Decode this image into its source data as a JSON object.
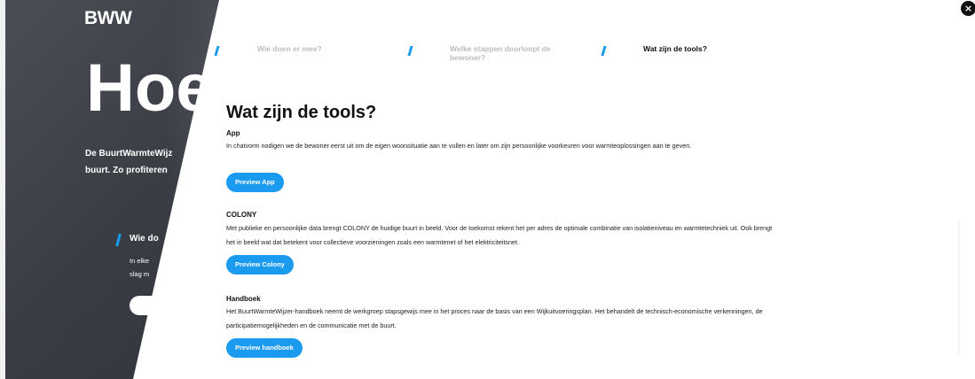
{
  "background": {
    "logo": "BWW",
    "hero_heading": "Hoe",
    "intro_line1": "De BuurtWarmteWijz",
    "intro_line2": "buurt. Zo profiteren",
    "sub_heading": "Wie do",
    "sub_text_line1": "In elke",
    "sub_text_line2": "slag m"
  },
  "close_icon": "×",
  "steps": [
    {
      "label": "Wie doen er mee?",
      "state": "inactive"
    },
    {
      "label": "Welke stappen doorloopt de bewoner?",
      "state": "inactive"
    },
    {
      "label": "Wat zijn de tools?",
      "state": "active"
    }
  ],
  "main": {
    "title": "Wat zijn de tools?",
    "sections": [
      {
        "heading": "App",
        "text": "In chatvorm nodigen we de bewoner eerst uit om de eigen woonsituatie aan te vullen en later om zijn persoonlijke voorkeuren voor warmteoplossingen aan te geven.",
        "button": "Preview App"
      },
      {
        "heading": "COLONY",
        "text": "Met publieke en persoonlijke data brengt COLONY de huidige buurt in beeld. Voor de toekomst rekent het per adres de optimale combinatie van isolatieniveau en warmtetechniek uit. Ook brengt het in beeld wat dat betekent voor collectieve voorzieningen zoals een warmtenet of het elektriciteitsnet.",
        "button": "Preview Colony"
      },
      {
        "heading": "Handboek",
        "text": "Het BuurtWarmteWijzer-handboek neemt de werkgroep stapsgewijs mee in het proces naar de basis van een Wijkuitvoeringsplan. Het behandelt de technisch-economische verkenningen, de participatiemogelijkheden en de communicatie met de buurt.",
        "button": "Preview handboek"
      }
    ]
  },
  "colors": {
    "accent": "#1a9bf0",
    "background_dark": "#3a3d44",
    "text": "#111111",
    "muted": "#bdbdbd"
  }
}
